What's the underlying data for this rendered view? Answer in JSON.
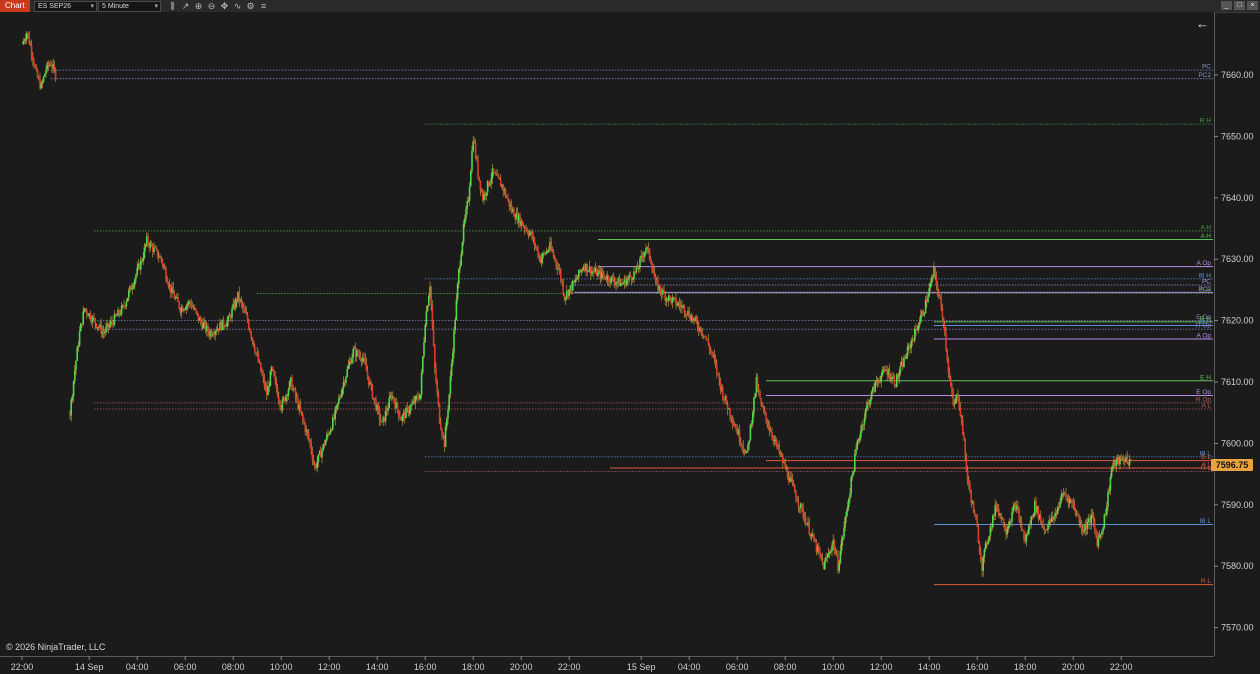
{
  "toolbar": {
    "chart_tab": "Chart",
    "instrument": "ES SEP26",
    "interval": "5 Minute",
    "tools": [
      {
        "name": "bar-type-icon",
        "glyph": "⫼"
      },
      {
        "name": "draw-tool-icon",
        "glyph": "↗"
      },
      {
        "name": "zoom-in-icon",
        "glyph": "⊕"
      },
      {
        "name": "zoom-out-icon",
        "glyph": "⊖"
      },
      {
        "name": "crosshair-icon",
        "glyph": "✥"
      },
      {
        "name": "indicators-icon",
        "glyph": "∿"
      },
      {
        "name": "strategies-icon",
        "glyph": "⚙"
      },
      {
        "name": "properties-icon",
        "glyph": "≡"
      }
    ]
  },
  "window_controls": {
    "minimize": "_",
    "maximize": "□",
    "close": "×"
  },
  "back_arrow": "←",
  "copyright": "© 2026 NinjaTrader, LLC",
  "current_price": "7596.75",
  "colors": {
    "background": "#1b1b1b",
    "up_bar": "#52d94a",
    "down_bar": "#e03b2a",
    "wick": "#d9a441",
    "price_badge": "#e8a33c"
  },
  "chart_data": {
    "type": "candlestick",
    "instrument": "ES SEP26",
    "interval": "5 Minute",
    "y_ticks": [
      "7570.00",
      "7580.00",
      "7590.00",
      "7600.00",
      "7610.00",
      "7620.00",
      "7630.00",
      "7640.00",
      "7650.00",
      "7660.00"
    ],
    "ylim": [
      7566.4,
      7666.2
    ],
    "x_ticks": [
      {
        "label": "22:00",
        "t": 0
      },
      {
        "label": "14 Sep",
        "t": 28
      },
      {
        "label": "04:00",
        "t": 48
      },
      {
        "label": "06:00",
        "t": 68
      },
      {
        "label": "08:00",
        "t": 88
      },
      {
        "label": "10:00",
        "t": 108
      },
      {
        "label": "12:00",
        "t": 128
      },
      {
        "label": "14:00",
        "t": 148
      },
      {
        "label": "16:00",
        "t": 168
      },
      {
        "label": "18:00",
        "t": 188
      },
      {
        "label": "20:00",
        "t": 208
      },
      {
        "label": "22:00",
        "t": 228
      },
      {
        "label": "15 Sep",
        "t": 258
      },
      {
        "label": "04:00",
        "t": 278
      },
      {
        "label": "06:00",
        "t": 298
      },
      {
        "label": "08:00",
        "t": 318
      },
      {
        "label": "10:00",
        "t": 338
      },
      {
        "label": "12:00",
        "t": 358
      },
      {
        "label": "14:00",
        "t": 378
      },
      {
        "label": "16:00",
        "t": 398
      },
      {
        "label": "18:00",
        "t": 418
      },
      {
        "label": "20:00",
        "t": 438
      },
      {
        "label": "22:00",
        "t": 458
      }
    ],
    "x_note": "t = hours after the first 22:00 label, times 10",
    "price_path": [
      [
        0,
        7665
      ],
      [
        2,
        7667
      ],
      [
        4,
        7664
      ],
      [
        6,
        7660
      ],
      [
        8,
        7658
      ],
      [
        10,
        7661
      ],
      [
        12,
        7662
      ],
      [
        14,
        7660
      ],
      [
        20,
        7605
      ],
      [
        22,
        7612
      ],
      [
        24,
        7618
      ],
      [
        26,
        7622
      ],
      [
        30,
        7620
      ],
      [
        34,
        7618
      ],
      [
        38,
        7620
      ],
      [
        42,
        7622
      ],
      [
        46,
        7626
      ],
      [
        50,
        7630
      ],
      [
        52,
        7633
      ],
      [
        54,
        7632
      ],
      [
        58,
        7630
      ],
      [
        62,
        7625
      ],
      [
        66,
        7622
      ],
      [
        70,
        7623
      ],
      [
        74,
        7620
      ],
      [
        78,
        7618
      ],
      [
        82,
        7619
      ],
      [
        86,
        7620
      ],
      [
        90,
        7624
      ],
      [
        94,
        7620
      ],
      [
        98,
        7614
      ],
      [
        102,
        7608
      ],
      [
        104,
        7612
      ],
      [
        108,
        7606
      ],
      [
        112,
        7610
      ],
      [
        116,
        7605
      ],
      [
        120,
        7600
      ],
      [
        122,
        7596
      ],
      [
        126,
        7600
      ],
      [
        130,
        7604
      ],
      [
        134,
        7610
      ],
      [
        138,
        7615
      ],
      [
        142,
        7614
      ],
      [
        146,
        7608
      ],
      [
        150,
        7603
      ],
      [
        154,
        7608
      ],
      [
        158,
        7604
      ],
      [
        162,
        7606
      ],
      [
        166,
        7608
      ],
      [
        168,
        7620
      ],
      [
        170,
        7626
      ],
      [
        172,
        7612
      ],
      [
        174,
        7604
      ],
      [
        176,
        7600
      ],
      [
        178,
        7608
      ],
      [
        180,
        7618
      ],
      [
        182,
        7628
      ],
      [
        184,
        7635
      ],
      [
        186,
        7640
      ],
      [
        188,
        7650
      ],
      [
        190,
        7644
      ],
      [
        192,
        7640
      ],
      [
        196,
        7644
      ],
      [
        200,
        7642
      ],
      [
        204,
        7638
      ],
      [
        208,
        7636
      ],
      [
        212,
        7634
      ],
      [
        216,
        7630
      ],
      [
        220,
        7632
      ],
      [
        224,
        7628
      ],
      [
        226,
        7624
      ],
      [
        230,
        7626
      ],
      [
        234,
        7629
      ],
      [
        238,
        7628
      ],
      [
        244,
        7627
      ],
      [
        250,
        7626
      ],
      [
        256,
        7628
      ],
      [
        258,
        7630
      ],
      [
        260,
        7632
      ],
      [
        262,
        7630
      ],
      [
        264,
        7626
      ],
      [
        268,
        7624
      ],
      [
        272,
        7623
      ],
      [
        276,
        7622
      ],
      [
        280,
        7620
      ],
      [
        284,
        7618
      ],
      [
        288,
        7614
      ],
      [
        292,
        7608
      ],
      [
        296,
        7604
      ],
      [
        300,
        7600
      ],
      [
        302,
        7598
      ],
      [
        304,
        7604
      ],
      [
        306,
        7610
      ],
      [
        308,
        7606
      ],
      [
        312,
        7602
      ],
      [
        316,
        7598
      ],
      [
        320,
        7594
      ],
      [
        324,
        7590
      ],
      [
        328,
        7586
      ],
      [
        332,
        7582
      ],
      [
        334,
        7580
      ],
      [
        338,
        7584
      ],
      [
        340,
        7580
      ],
      [
        344,
        7590
      ],
      [
        348,
        7600
      ],
      [
        352,
        7606
      ],
      [
        356,
        7610
      ],
      [
        360,
        7612
      ],
      [
        364,
        7610
      ],
      [
        368,
        7614
      ],
      [
        372,
        7618
      ],
      [
        376,
        7622
      ],
      [
        380,
        7628
      ],
      [
        382,
        7624
      ],
      [
        384,
        7620
      ],
      [
        386,
        7612
      ],
      [
        388,
        7606
      ],
      [
        390,
        7608
      ],
      [
        392,
        7602
      ],
      [
        394,
        7594
      ],
      [
        398,
        7586
      ],
      [
        400,
        7580
      ],
      [
        402,
        7584
      ],
      [
        406,
        7590
      ],
      [
        410,
        7586
      ],
      [
        414,
        7590
      ],
      [
        418,
        7584
      ],
      [
        422,
        7590
      ],
      [
        426,
        7586
      ],
      [
        430,
        7588
      ],
      [
        434,
        7592
      ],
      [
        438,
        7590
      ],
      [
        442,
        7586
      ],
      [
        446,
        7588
      ],
      [
        448,
        7584
      ],
      [
        450,
        7586
      ],
      [
        452,
        7590
      ],
      [
        454,
        7596
      ],
      [
        456,
        7597
      ],
      [
        460,
        7597.5
      ],
      [
        462,
        7596.75
      ]
    ],
    "levels": [
      {
        "label": "PC",
        "price": 7660.8,
        "color": "#8a8fc4",
        "style": "dotted",
        "t_from": 12
      },
      {
        "label": "PC2",
        "price": 7659.4,
        "color": "#8a8fc4",
        "style": "dotted",
        "t_from": 12
      },
      {
        "label": "R H",
        "price": 7652.0,
        "color": "#4d9a4a",
        "style": "dotted",
        "t_from": 168
      },
      {
        "label": "A H",
        "price": 7634.6,
        "color": "#4d9a4a",
        "style": "dotted",
        "t_from": 30
      },
      {
        "label": "A H",
        "price": 7633.2,
        "color": "#5ec45a",
        "style": "solid",
        "t_from": 240
      },
      {
        "label": "A Op",
        "price": 7628.8,
        "color": "#b98ee8",
        "style": "solid",
        "t_from": 240
      },
      {
        "label": "IB H",
        "price": 7626.8,
        "color": "#5b8fd6",
        "style": "dotted",
        "t_from": 168
      },
      {
        "label": "PC",
        "price": 7625.8,
        "color": "#9b9bd8",
        "style": "dotted",
        "t_from": 230
      },
      {
        "label": "PC2",
        "price": 7624.6,
        "color": "#b98ee8",
        "style": "solid",
        "t_from": 230
      },
      {
        "label": "E H",
        "price": 7624.4,
        "color": "#4d9a4a",
        "style": "dotted",
        "t_from": 98
      },
      {
        "label": "E Op",
        "price": 7620.0,
        "color": "#8a7fb8",
        "style": "dotted",
        "t_from": 30
      },
      {
        "label": "R H",
        "price": 7619.8,
        "color": "#5ec45a",
        "style": "solid",
        "t_from": 380
      },
      {
        "label": "IB H",
        "price": 7619.2,
        "color": "#5b8fd6",
        "style": "solid",
        "t_from": 380
      },
      {
        "label": "R Op",
        "price": 7618.6,
        "color": "#7a7ab8",
        "style": "dotted",
        "t_from": 30
      },
      {
        "label": "A Op",
        "price": 7617.0,
        "color": "#b98ee8",
        "style": "solid",
        "t_from": 380
      },
      {
        "label": "E H",
        "price": 7610.2,
        "color": "#5ec45a",
        "style": "solid",
        "t_from": 310
      },
      {
        "label": "E Op",
        "price": 7607.8,
        "color": "#b98ee8",
        "style": "solid",
        "t_from": 310
      },
      {
        "label": "R Op",
        "price": 7606.6,
        "color": "#b85a5a",
        "style": "dotted",
        "t_from": 30
      },
      {
        "label": "A L",
        "price": 7605.6,
        "color": "#b85a5a",
        "style": "dotted",
        "t_from": 30
      },
      {
        "label": "IB L",
        "price": 7597.8,
        "color": "#5b8fd6",
        "style": "dotted",
        "t_from": 168
      },
      {
        "label": "E L",
        "price": 7597.2,
        "color": "#e05a3a",
        "style": "solid",
        "t_from": 310
      },
      {
        "label": "A L",
        "price": 7596.0,
        "color": "#e05a3a",
        "style": "solid",
        "t_from": 245
      },
      {
        "label": "R L",
        "price": 7595.4,
        "color": "#b85a5a",
        "style": "dotted",
        "t_from": 168
      },
      {
        "label": "IB L",
        "price": 7586.8,
        "color": "#5b8fd6",
        "style": "solid",
        "t_from": 380
      },
      {
        "label": "R L",
        "price": 7577.0,
        "color": "#e05a3a",
        "style": "solid",
        "t_from": 380
      }
    ]
  }
}
